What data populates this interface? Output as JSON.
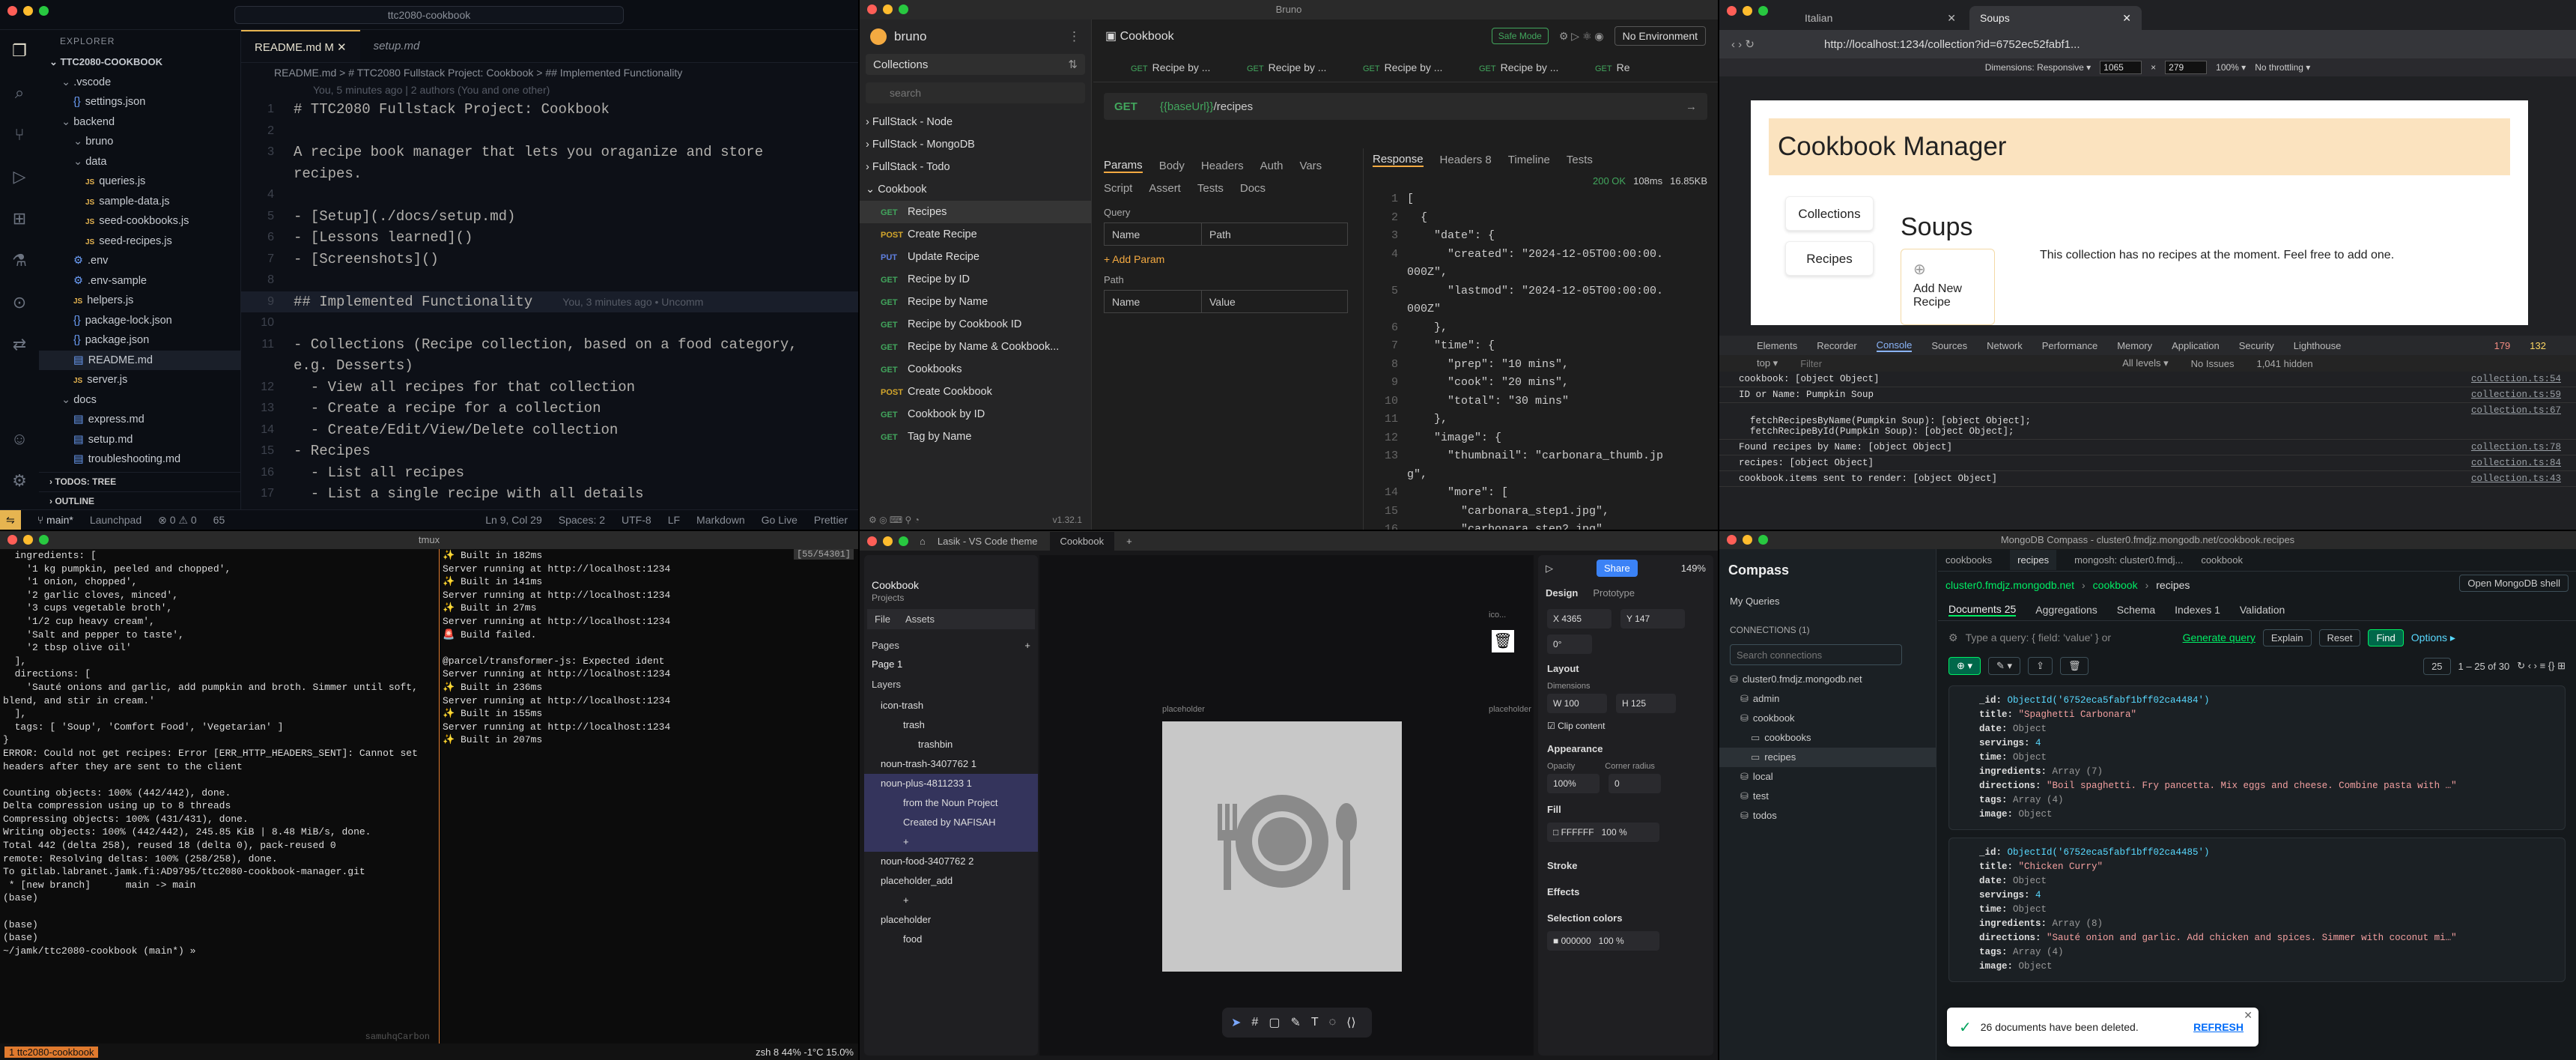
{
  "vscode": {
    "search_text": "ttc2080-cookbook",
    "explorer_title": "EXPLORER",
    "root": "TTC2080-COOKBOOK",
    "tree": [
      {
        "label": ".vscode",
        "type": "folder",
        "depth": 1
      },
      {
        "label": "settings.json",
        "type": "json",
        "depth": 2
      },
      {
        "label": "backend",
        "type": "folder",
        "depth": 1
      },
      {
        "label": "bruno",
        "type": "folder",
        "depth": 2
      },
      {
        "label": "data",
        "type": "folder",
        "depth": 2
      },
      {
        "label": "queries.js",
        "type": "js",
        "depth": 3
      },
      {
        "label": "sample-data.js",
        "type": "js",
        "depth": 3
      },
      {
        "label": "seed-cookbooks.js",
        "type": "js",
        "depth": 3
      },
      {
        "label": "seed-recipes.js",
        "type": "js",
        "depth": 3
      },
      {
        "label": ".env",
        "type": "env",
        "depth": 2
      },
      {
        "label": ".env-sample",
        "type": "env",
        "depth": 2
      },
      {
        "label": "helpers.js",
        "type": "js",
        "depth": 2
      },
      {
        "label": "package-lock.json",
        "type": "json",
        "depth": 2
      },
      {
        "label": "package.json",
        "type": "json",
        "depth": 2
      },
      {
        "label": "README.md",
        "type": "md",
        "depth": 2
      },
      {
        "label": "server.js",
        "type": "js",
        "depth": 2
      },
      {
        "label": "docs",
        "type": "folder",
        "depth": 1
      },
      {
        "label": "express.md",
        "type": "md",
        "depth": 2
      },
      {
        "label": "setup.md",
        "type": "md",
        "depth": 2
      },
      {
        "label": "troubleshooting.md",
        "type": "md",
        "depth": 2
      }
    ],
    "todos": "TODOS: TREE",
    "outline": "OUTLINE",
    "tabs": [
      {
        "label": "README.md M"
      },
      {
        "label": "setup.md"
      }
    ],
    "breadcrumb": "README.md > # TTC2080 Fullstack Project: Cookbook > ## Implemented Functionality",
    "blame": "You, 5 minutes ago | 2 authors (You and one other)",
    "code": [
      {
        "n": "1",
        "t": "# TTC2080 Fullstack Project: Cookbook",
        "c": "head"
      },
      {
        "n": "2",
        "t": "",
        "c": ""
      },
      {
        "n": "3",
        "t": "A recipe book manager that lets you oraganize and store",
        "c": ""
      },
      {
        "n": "",
        "t": "recipes.",
        "c": ""
      },
      {
        "n": "4",
        "t": "",
        "c": ""
      },
      {
        "n": "5",
        "t": "- [Setup](./docs/setup.md)",
        "c": "link"
      },
      {
        "n": "6",
        "t": "- [Lessons learned]()",
        "c": "link"
      },
      {
        "n": "7",
        "t": "- [Screenshots]()",
        "c": "link"
      },
      {
        "n": "8",
        "t": "",
        "c": ""
      },
      {
        "n": "9",
        "t": "## Implemented Functionality",
        "c": "head",
        "blame": "You, 3 minutes ago • Uncomm"
      },
      {
        "n": "10",
        "t": "",
        "c": ""
      },
      {
        "n": "11",
        "t": "- Collections (Recipe collection, based on a food category,",
        "c": ""
      },
      {
        "n": "",
        "t": "e.g. Desserts)",
        "c": ""
      },
      {
        "n": "12",
        "t": "  - View all recipes for that collection",
        "c": ""
      },
      {
        "n": "13",
        "t": "  - Create a recipe for a collection",
        "c": ""
      },
      {
        "n": "14",
        "t": "  - Create/Edit/View/Delete collection",
        "c": ""
      },
      {
        "n": "15",
        "t": "- Recipes",
        "c": ""
      },
      {
        "n": "16",
        "t": "  - List all recipes",
        "c": ""
      },
      {
        "n": "17",
        "t": "  - List a single recipe with all details",
        "c": ""
      }
    ],
    "status": {
      "branch": "main*",
      "launchpad": "Launchpad",
      "problems": "⊗ 0 ⚠ 0",
      "ports": "65",
      "ln": "Ln 9, Col 29",
      "spaces": "Spaces: 2",
      "enc": "UTF-8",
      "eol": "LF",
      "lang": "Markdown",
      "golive": "Go Live",
      "prettier": "Prettier"
    }
  },
  "bruno": {
    "window_title": "Bruno",
    "app": "bruno",
    "collections_label": "Collections",
    "search_placeholder": "search",
    "groups": [
      "FullStack - Node",
      "FullStack - MongoDB",
      "FullStack - Todo",
      "Cookbook"
    ],
    "items": [
      {
        "m": "GET",
        "l": "Recipes"
      },
      {
        "m": "POST",
        "l": "Create Recipe"
      },
      {
        "m": "PUT",
        "l": "Update Recipe"
      },
      {
        "m": "GET",
        "l": "Recipe by ID"
      },
      {
        "m": "GET",
        "l": "Recipe by Name"
      },
      {
        "m": "GET",
        "l": "Recipe by Cookbook ID"
      },
      {
        "m": "GET",
        "l": "Recipe by Name & Cookbook..."
      },
      {
        "m": "GET",
        "l": "Cookbooks"
      },
      {
        "m": "POST",
        "l": "Create Cookbook"
      },
      {
        "m": "GET",
        "l": "Cookbook by ID"
      },
      {
        "m": "GET",
        "l": "Tag by Name"
      }
    ],
    "version": "v1.32.1",
    "collection": "Cookbook",
    "safe_mode": "Safe Mode",
    "env": "No Environment",
    "rtabs": [
      "Recipe by ...",
      "Recipe by ...",
      "Recipe by ...",
      "Recipe by ...",
      "Re"
    ],
    "method": "GET",
    "url_var": "{{baseUrl}}",
    "url_path": "/recipes",
    "ptabs": [
      "Params",
      "Body",
      "Headers",
      "Auth",
      "Vars",
      "Script",
      "Assert",
      "Tests",
      "Docs"
    ],
    "query_label": "Query",
    "col_name": "Name",
    "col_path": "Path",
    "col_value": "Value",
    "add_param": "+ Add Param",
    "path_label": "Path",
    "resp_tabs": [
      "Response",
      "Headers 8",
      "Timeline",
      "Tests"
    ],
    "status_code": "200 OK",
    "time": "108ms",
    "size": "16.85KB",
    "json": [
      {
        "n": "1",
        "t": "["
      },
      {
        "n": "2",
        "t": "  {"
      },
      {
        "n": "3",
        "t": "    \"date\": {"
      },
      {
        "n": "4",
        "t": "      \"created\": \"2024-12-05T00:00:00."
      },
      {
        "n": "",
        "t": "000Z\","
      },
      {
        "n": "5",
        "t": "      \"lastmod\": \"2024-12-05T00:00:00."
      },
      {
        "n": "",
        "t": "000Z\""
      },
      {
        "n": "6",
        "t": "    },"
      },
      {
        "n": "7",
        "t": "    \"time\": {"
      },
      {
        "n": "8",
        "t": "      \"prep\": \"10 mins\","
      },
      {
        "n": "9",
        "t": "      \"cook\": \"20 mins\","
      },
      {
        "n": "10",
        "t": "      \"total\": \"30 mins\""
      },
      {
        "n": "11",
        "t": "    },"
      },
      {
        "n": "12",
        "t": "    \"image\": {"
      },
      {
        "n": "13",
        "t": "      \"thumbnail\": \"carbonara_thumb.jp"
      },
      {
        "n": "",
        "t": "g\","
      },
      {
        "n": "14",
        "t": "      \"more\": ["
      },
      {
        "n": "15",
        "t": "        \"carbonara_step1.jpg\","
      },
      {
        "n": "16",
        "t": "        \"carbonara_step2.jpg\""
      },
      {
        "n": "17",
        "t": "      ]"
      },
      {
        "n": "18",
        "t": "    },"
      }
    ]
  },
  "chrome": {
    "tabs": [
      "Italian",
      "Soups"
    ],
    "url": "http://localhost:1234/collection?id=6752ec52fabf1...",
    "dims_label": "Dimensions: Responsive ▾",
    "dim_w": "1065",
    "dim_h": "279",
    "zoom": "100% ▾",
    "throttle": "No throttling ▾",
    "site_title": "Cookbook Manager",
    "nav": [
      "Collections",
      "Recipes"
    ],
    "heading": "Soups",
    "add_new": "Add New Recipe",
    "empty_msg": "This collection has no recipes at the moment. Feel free to add one.",
    "devtools_tabs": [
      "Elements",
      "Recorder",
      "Console",
      "Sources",
      "Network",
      "Performance",
      "Memory",
      "Application",
      "Security",
      "Lighthouse"
    ],
    "errors": "179",
    "warnings": "132",
    "filter_placeholder": "Filter",
    "context": "top ▾",
    "levels": "All levels ▾",
    "issues": "No Issues",
    "hidden": "1,041 hidden",
    "logs": [
      {
        "t": "cookbook: [object Object]",
        "s": "collection.ts:54"
      },
      {
        "t": "ID or Name: Pumpkin Soup",
        "s": "collection.ts:59"
      },
      {
        "t": "\n  fetchRecipesByName(Pumpkin Soup): [object Object];\n  fetchRecipeById(Pumpkin Soup): [object Object];",
        "s": "collection.ts:67"
      },
      {
        "t": "Found recipes by Name: [object Object]",
        "s": "collection.ts:78"
      },
      {
        "t": "recipes: [object Object]",
        "s": "collection.ts:84"
      },
      {
        "t": "cookbook.items sent to render: [object Object]",
        "s": "collection.ts:43"
      }
    ]
  },
  "tmux": {
    "title": "tmux",
    "counter": "[55/54301]",
    "left_lines": [
      {
        "t": "  ingredients: [",
        "c": ""
      },
      {
        "t": "    '1 kg pumpkin, peeled and chopped',",
        "c": ""
      },
      {
        "t": "    '1 onion, chopped',",
        "c": ""
      },
      {
        "t": "    '2 garlic cloves, minced',",
        "c": ""
      },
      {
        "t": "    '3 cups vegetable broth',",
        "c": ""
      },
      {
        "t": "    '1/2 cup heavy cream',",
        "c": ""
      },
      {
        "t": "    'Salt and pepper to taste',",
        "c": ""
      },
      {
        "t": "    '2 tbsp olive oil'",
        "c": ""
      },
      {
        "t": "  ],",
        "c": ""
      },
      {
        "t": "  directions: [",
        "c": ""
      },
      {
        "t": "    'Sauté onions and garlic, add pumpkin and broth. Simmer until soft,",
        "c": ""
      },
      {
        "t": "blend, and stir in cream.'",
        "c": ""
      },
      {
        "t": "  ],",
        "c": ""
      },
      {
        "t": "  tags: [ 'Soup', 'Comfort Food', 'Vegetarian' ]",
        "c": ""
      },
      {
        "t": "}",
        "c": ""
      },
      {
        "t": "ERROR: Could not get recipes: Error [ERR_HTTP_HEADERS_SENT]: Cannot set",
        "c": ""
      },
      {
        "t": "headers after they are sent to the client",
        "c": ""
      },
      {
        "t": "",
        "c": ""
      },
      {
        "t": "Counting objects: 100% (442/442), done.",
        "c": ""
      },
      {
        "t": "Delta compression using up to 8 threads",
        "c": ""
      },
      {
        "t": "Compressing objects: 100% (431/431), done.",
        "c": ""
      },
      {
        "t": "Writing objects: 100% (442/442), 245.85 KiB | 8.48 MiB/s, done.",
        "c": ""
      },
      {
        "t": "Total 442 (delta 258), reused 18 (delta 0), pack-reused 0",
        "c": ""
      },
      {
        "t": "remote: Resolving deltas: 100% (258/258), done.",
        "c": ""
      },
      {
        "t": "To gitlab.labranet.jamk.fi:AD9795/ttc2080-cookbook-manager.git",
        "c": ""
      },
      {
        "t": " * [new branch]      main -> main",
        "c": ""
      },
      {
        "t": "(base)",
        "c": ""
      },
      {
        "t": "",
        "c": ""
      },
      {
        "t": "(base)",
        "c": ""
      },
      {
        "t": "(base)",
        "c": ""
      },
      {
        "t": "~/jamk/ttc2080-cookbook (main*) »",
        "c": "blue"
      }
    ],
    "right_lines": [
      {
        "t": "✨ Built in 182ms",
        "c": "green"
      },
      {
        "t": "Server running at http://localhost:1234",
        "c": "blue"
      },
      {
        "t": "✨ Built in 141ms",
        "c": "green"
      },
      {
        "t": "Server running at http://localhost:1234",
        "c": "blue"
      },
      {
        "t": "✨ Built in 27ms",
        "c": "green"
      },
      {
        "t": "Server running at http://localhost:1234",
        "c": "blue"
      },
      {
        "t": "🚨 Build failed.",
        "c": "red"
      },
      {
        "t": "",
        "c": ""
      },
      {
        "t": "@parcel/transformer-js: Expected ident",
        "c": "red"
      },
      {
        "t": "Server running at http://localhost:1234",
        "c": "blue"
      },
      {
        "t": "✨ Built in 236ms",
        "c": "green"
      },
      {
        "t": "Server running at http://localhost:1234",
        "c": "blue"
      },
      {
        "t": "✨ Built in 155ms",
        "c": "green"
      },
      {
        "t": "Server running at http://localhost:1234",
        "c": "blue"
      },
      {
        "t": "✨ Built in 207ms",
        "c": "green"
      }
    ],
    "prompt_user": "samuhqCarbon",
    "status_left": "1  ttc2080-cookbook",
    "status_right": "zsh  8  44%  -1°C  15.0%"
  },
  "penpot": {
    "tabs": [
      "Lasik - VS Code theme",
      "Cookbook"
    ],
    "project": "Cookbook",
    "projects_label": "Projects",
    "file_tabs": [
      "File",
      "Assets"
    ],
    "pages_label": "Pages",
    "page1": "Page 1",
    "layers_label": "Layers",
    "layers": [
      {
        "l": "icon-trash",
        "d": 0,
        "sel": false
      },
      {
        "l": "trash",
        "d": 1,
        "sel": false
      },
      {
        "l": "trashbin",
        "d": 2,
        "sel": false
      },
      {
        "l": "noun-trash-3407762 1",
        "d": 0,
        "sel": false
      },
      {
        "l": "noun-plus-4811233 1",
        "d": 0,
        "sel": true
      },
      {
        "l": "from the Noun Project",
        "d": 1,
        "sel": true
      },
      {
        "l": "Created by NAFISAH",
        "d": 1,
        "sel": true
      },
      {
        "l": "+",
        "d": 1,
        "sel": true
      },
      {
        "l": "noun-food-3407762 2",
        "d": 0,
        "sel": false
      },
      {
        "l": "placeholder_add",
        "d": 0,
        "sel": false
      },
      {
        "l": "+",
        "d": 1,
        "sel": false
      },
      {
        "l": "placeholder",
        "d": 0,
        "sel": false
      },
      {
        "l": "food",
        "d": 1,
        "sel": false
      }
    ],
    "board_label": "placeholder",
    "board_label2": "placeholder",
    "ico_label": "ico...",
    "share": "Share",
    "zoom": "149%",
    "design_tabs": [
      "Design",
      "Prototype"
    ],
    "x": "4365",
    "y": "147",
    "rotation": "0°",
    "layout_label": "Layout",
    "dims_label": "Dimensions",
    "w": "100",
    "h": "125",
    "clip": "Clip content",
    "appearance": "Appearance",
    "opacity_label": "Opacity",
    "opacity": "100%",
    "radius_label": "Corner radius",
    "radius": "0",
    "fill": "Fill",
    "fill_hex": "FFFFFF",
    "fill_op": "100",
    "stroke": "Stroke",
    "effects": "Effects",
    "sel_colors": "Selection colors",
    "sel_hex": "000000",
    "sel_op": "100"
  },
  "compass": {
    "title": "MongoDB Compass - cluster0.fmdjz.mongodb.net/cookbook.recipes",
    "brand": "Compass",
    "my_queries": "My Queries",
    "connections": "CONNECTIONS (1)",
    "search_placeholder": "Search connections",
    "tree": [
      {
        "l": "cluster0.fmdjz.mongodb.net",
        "d": 0
      },
      {
        "l": "admin",
        "d": 1
      },
      {
        "l": "cookbook",
        "d": 1
      },
      {
        "l": "cookbooks",
        "d": 2
      },
      {
        "l": "recipes",
        "d": 2
      },
      {
        "l": "local",
        "d": 1
      },
      {
        "l": "test",
        "d": 1
      },
      {
        "l": "todos",
        "d": 1
      }
    ],
    "tabs": [
      "cookbooks",
      "recipes",
      "mongosh: cluster0.fmdj...",
      "cookbook"
    ],
    "crumbs": [
      "cluster0.fmdjz.mongodb.net",
      "cookbook",
      "recipes"
    ],
    "open_shell": "Open MongoDB shell",
    "subtabs": [
      "Documents 25",
      "Aggregations",
      "Schema",
      "Indexes 1",
      "Validation"
    ],
    "query_placeholder": "Type a query: { field: 'value' } or",
    "generate": "Generate query",
    "explain": "Explain",
    "reset": "Reset",
    "find": "Find",
    "options": "Options ▸",
    "page_size": "25",
    "range": "1 – 25 of 30",
    "docs": [
      {
        "id": "ObjectId('6752eca5fabf1bff02ca4484')",
        "title": "\"Spaghetti Carbonara\"",
        "servings": "4",
        "ing": "Array (7)",
        "dir": "\"Boil spaghetti. Fry pancetta. Mix eggs and cheese. Combine pasta with …\"",
        "tags": "Array (4)"
      },
      {
        "id": "ObjectId('6752eca5fabf1bff02ca4485')",
        "title": "\"Chicken Curry\"",
        "servings": "4",
        "ing": "Array (8)",
        "dir": "\"Sauté onion and garlic. Add chicken and spices. Simmer with coconut mi…\"",
        "tags": "Array (4)"
      }
    ],
    "toast": "26 documents have been deleted.",
    "refresh": "REFRESH"
  }
}
